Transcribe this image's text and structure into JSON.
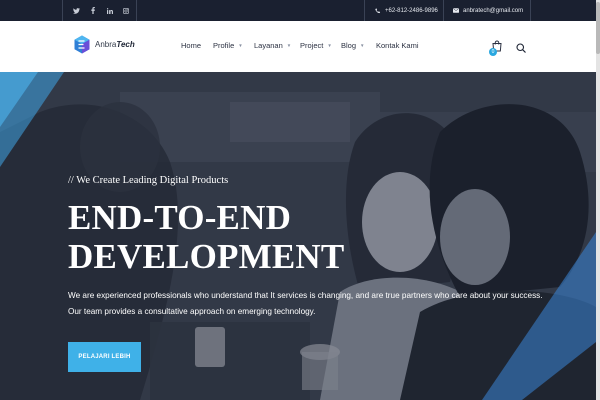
{
  "topbar": {
    "social": [
      "twitter-icon",
      "facebook-icon",
      "linkedin-icon",
      "instagram-icon"
    ],
    "phone": "+62-812-2486-9896",
    "email": "anbratech@gmail.com"
  },
  "brand": {
    "name_regular": "Anbra",
    "name_bold": "Tech",
    "accent_color": "#3fb1e8",
    "topbar_color": "#1a2030"
  },
  "nav": {
    "items": [
      {
        "label": "Home",
        "has_dropdown": false
      },
      {
        "label": "Profile",
        "has_dropdown": true
      },
      {
        "label": "Layanan",
        "has_dropdown": true
      },
      {
        "label": "Project",
        "has_dropdown": true
      },
      {
        "label": "Blog",
        "has_dropdown": true
      },
      {
        "label": "Kontak Kami",
        "has_dropdown": false
      }
    ],
    "caret": "▼",
    "cart_count": "0"
  },
  "hero": {
    "eyebrow": "// We Create Leading Digital Products",
    "headline_line1": "END-TO-END",
    "headline_line2": "DEVELOPMENT",
    "desc_line1": "We are experienced professionals who understand that It services is changing, and are true partners who care about your success.",
    "desc_line2": "Our team provides a consultative approach on emerging technology.",
    "cta_label": "PELAJARI LEBIH"
  }
}
